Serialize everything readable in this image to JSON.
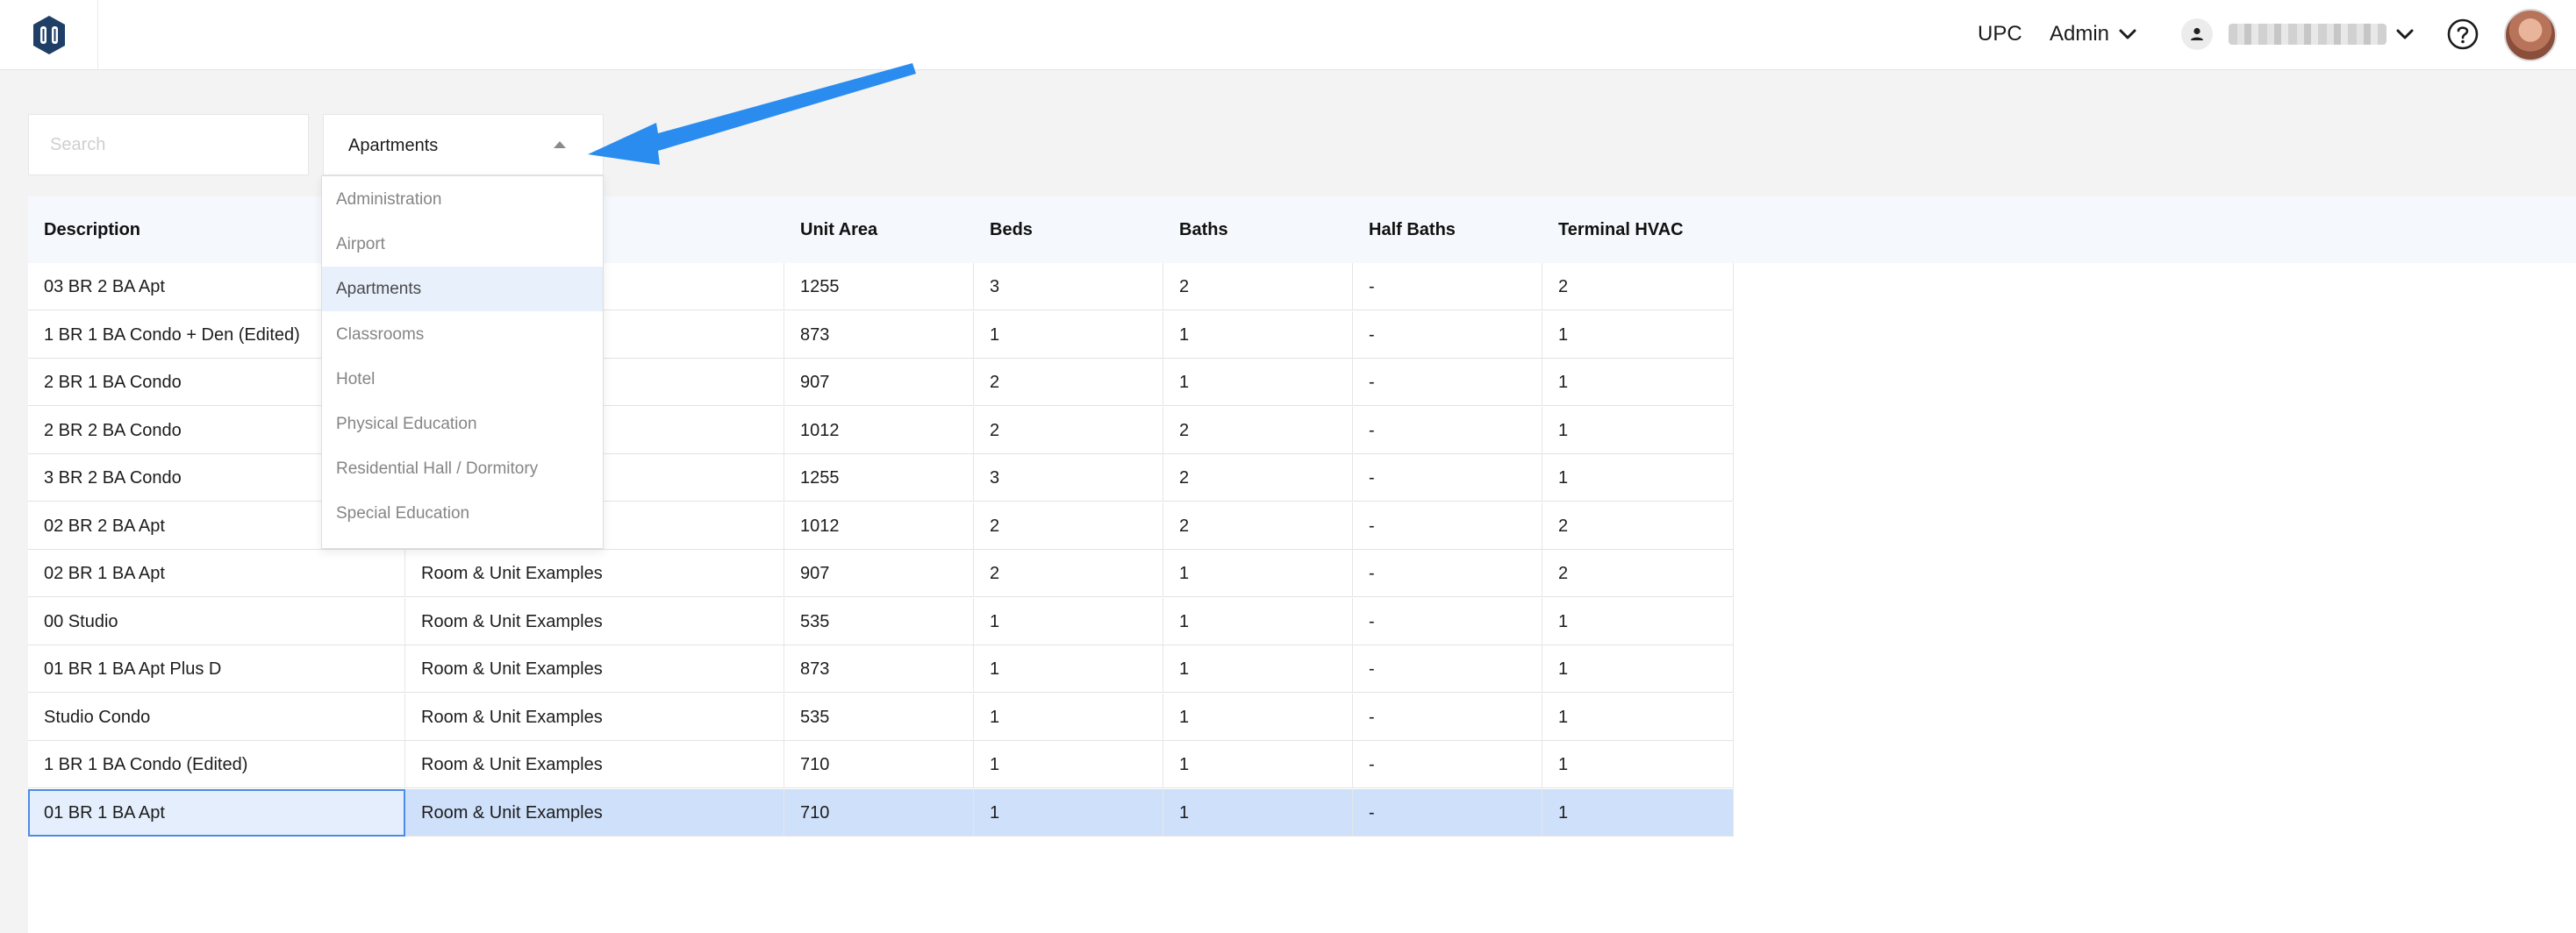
{
  "topbar": {
    "logo_icon": "logo-icon",
    "upc_label": "UPC",
    "admin_label": "Admin",
    "user_icon": "person-icon",
    "help_icon": "help-icon"
  },
  "search": {
    "placeholder": "Search",
    "value": ""
  },
  "category_select": {
    "selected": "Apartments",
    "options": [
      "Administration",
      "Airport",
      "Apartments",
      "Classrooms",
      "Hotel",
      "Physical Education",
      "Residential Hall / Dormitory",
      "Special Education"
    ]
  },
  "table": {
    "columns": [
      "Description",
      "",
      "Unit Area",
      "Beds",
      "Baths",
      "Half Baths",
      "Terminal HVAC"
    ],
    "rows": [
      [
        "03 BR 2 BA Apt",
        "",
        "1255",
        "3",
        "2",
        "-",
        "2"
      ],
      [
        "1 BR 1 BA Condo + Den (Edited)",
        "",
        "873",
        "1",
        "1",
        "-",
        "1"
      ],
      [
        "2 BR 1 BA Condo",
        "",
        "907",
        "2",
        "1",
        "-",
        "1"
      ],
      [
        "2 BR 2 BA Condo",
        "",
        "1012",
        "2",
        "2",
        "-",
        "1"
      ],
      [
        "3 BR 2 BA Condo",
        "",
        "1255",
        "3",
        "2",
        "-",
        "1"
      ],
      [
        "02 BR 2 BA Apt",
        "",
        "1012",
        "2",
        "2",
        "-",
        "2"
      ],
      [
        "02 BR 1 BA Apt",
        "Room & Unit Examples",
        "907",
        "2",
        "1",
        "-",
        "2"
      ],
      [
        "00 Studio",
        "Room & Unit Examples",
        "535",
        "1",
        "1",
        "-",
        "1"
      ],
      [
        "01 BR 1 BA Apt Plus D",
        "Room & Unit Examples",
        "873",
        "1",
        "1",
        "-",
        "1"
      ],
      [
        "Studio Condo",
        "Room & Unit Examples",
        "535",
        "1",
        "1",
        "-",
        "1"
      ],
      [
        "1 BR 1 BA Condo (Edited)",
        "Room & Unit Examples",
        "710",
        "1",
        "1",
        "-",
        "1"
      ],
      [
        "01 BR 1 BA Apt",
        "Room & Unit Examples",
        "710",
        "1",
        "1",
        "-",
        "1"
      ]
    ]
  },
  "colors": {
    "accent": "#2b8cf0",
    "selected_row": "#cfe0fa",
    "header_bg": "#f5f8fc"
  }
}
